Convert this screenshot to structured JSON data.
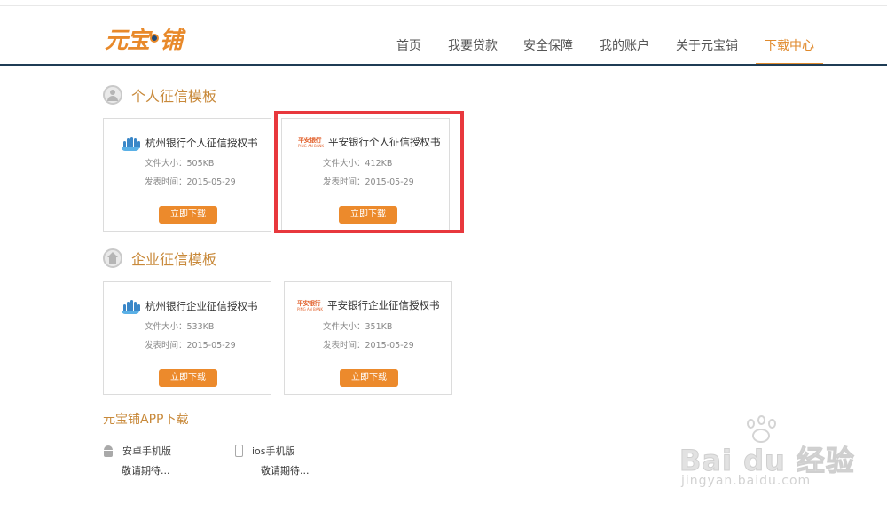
{
  "brand": {
    "name": "元宝铺",
    "name_part1": "元宝",
    "name_part2": "铺",
    "color": "#e8892a"
  },
  "nav": {
    "items": [
      {
        "label": "首页"
      },
      {
        "label": "我要贷款"
      },
      {
        "label": "安全保障"
      },
      {
        "label": "我的账户"
      },
      {
        "label": "关于元宝铺"
      },
      {
        "label": "下载中心"
      }
    ],
    "active": "下载中心",
    "accent": "#e08a2c",
    "line_color": "#1f3c55"
  },
  "personal": {
    "title": "个人征信模板",
    "icon": "person-icon",
    "cards": [
      {
        "bank_logo": "hangzhou-bank-logo",
        "title": "杭州银行个人征信授权书",
        "size": "文件大小：505KB",
        "date": "发表时间：2015-05-29",
        "button": "立即下载"
      },
      {
        "bank_logo": "pingan-bank-logo",
        "logo_text": "平安银行",
        "logo_sub": "PING AN BANK",
        "title": "平安银行个人征信授权书",
        "size": "文件大小：412KB",
        "date": "发表时间：2015-05-29",
        "button": "立即下载",
        "highlighted": true
      }
    ]
  },
  "enterprise": {
    "title": "企业征信模板",
    "icon": "house-icon",
    "cards": [
      {
        "bank_logo": "hangzhou-bank-logo",
        "title": "杭州银行企业征信授权书",
        "size": "文件大小：533KB",
        "date": "发表时间：2015-05-29",
        "button": "立即下载"
      },
      {
        "bank_logo": "pingan-bank-logo",
        "logo_text": "平安银行",
        "logo_sub": "PING AN BANK",
        "title": "平安银行企业征信授权书",
        "size": "文件大小：351KB",
        "date": "发表时间：2015-05-29",
        "button": "立即下载"
      }
    ]
  },
  "app": {
    "title": "元宝铺APP下载",
    "items": [
      {
        "icon": "android-icon",
        "name": "安卓手机版",
        "status": "敬请期待..."
      },
      {
        "icon": "phone-icon",
        "name": "ios手机版",
        "status": "敬请期待..."
      }
    ]
  },
  "watermark": {
    "text": "Bai du 经验",
    "url": "jingyan.baidu.com"
  },
  "colors": {
    "button": "#ec8a2c",
    "section_title": "#c8893a",
    "highlight_border": "#e8383d"
  }
}
